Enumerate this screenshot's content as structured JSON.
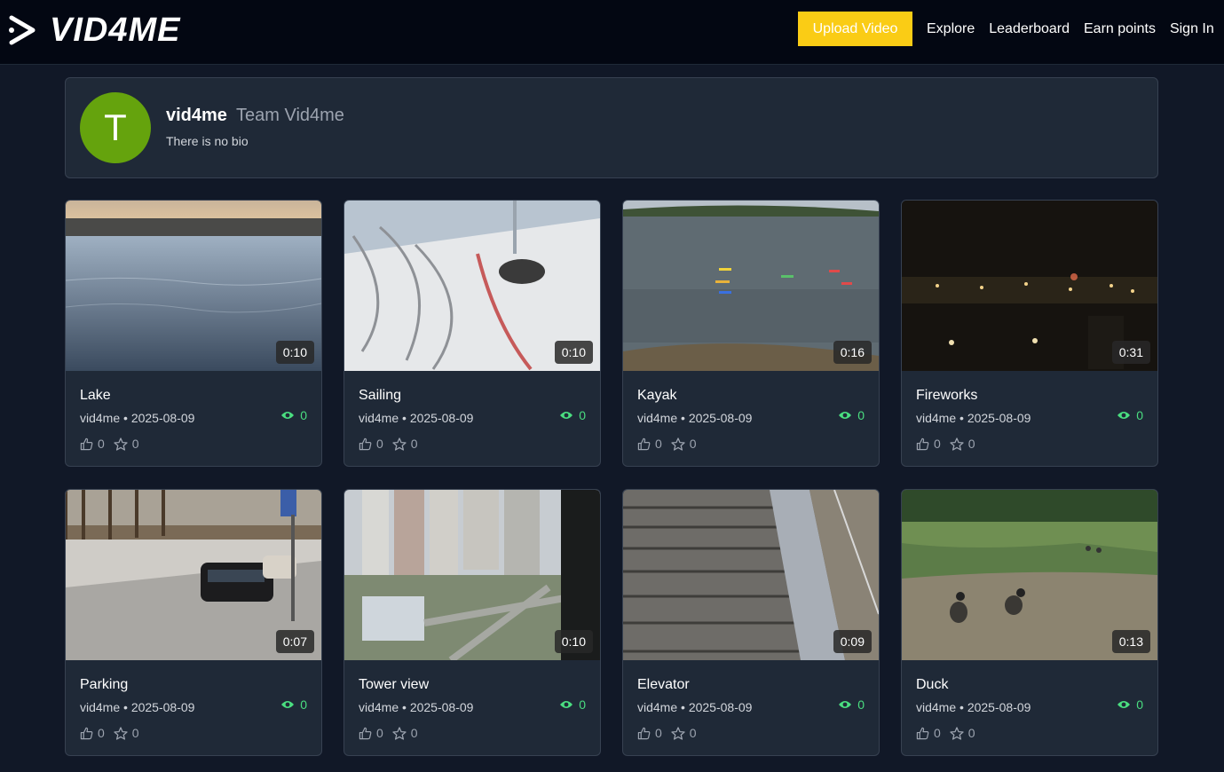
{
  "brand": {
    "name": "VID4ME"
  },
  "nav": {
    "upload_label": "Upload Video",
    "links": [
      "Explore",
      "Leaderboard",
      "Earn points",
      "Sign In"
    ]
  },
  "profile": {
    "avatar_letter": "T",
    "username": "vid4me",
    "team": "Team Vid4me",
    "bio": "There is no bio"
  },
  "colors": {
    "background": "#111827",
    "card": "#1f2937",
    "accent_upload": "#facc15",
    "views": "#4ade80",
    "avatar": "#65a30d"
  },
  "videos": [
    {
      "title": "Lake",
      "author": "vid4me",
      "date": "2025-08-09",
      "duration": "0:10",
      "views": "0",
      "likes": "0",
      "stars": "0"
    },
    {
      "title": "Sailing",
      "author": "vid4me",
      "date": "2025-08-09",
      "duration": "0:10",
      "views": "0",
      "likes": "0",
      "stars": "0"
    },
    {
      "title": "Kayak",
      "author": "vid4me",
      "date": "2025-08-09",
      "duration": "0:16",
      "views": "0",
      "likes": "0",
      "stars": "0"
    },
    {
      "title": "Fireworks",
      "author": "vid4me",
      "date": "2025-08-09",
      "duration": "0:31",
      "views": "0",
      "likes": "0",
      "stars": "0"
    },
    {
      "title": "Parking",
      "author": "vid4me",
      "date": "2025-08-09",
      "duration": "0:07",
      "views": "0",
      "likes": "0",
      "stars": "0"
    },
    {
      "title": "Tower view",
      "author": "vid4me",
      "date": "2025-08-09",
      "duration": "0:10",
      "views": "0",
      "likes": "0",
      "stars": "0"
    },
    {
      "title": "Elevator",
      "author": "vid4me",
      "date": "2025-08-09",
      "duration": "0:09",
      "views": "0",
      "likes": "0",
      "stars": "0"
    },
    {
      "title": "Duck",
      "author": "vid4me",
      "date": "2025-08-09",
      "duration": "0:13",
      "views": "0",
      "likes": "0",
      "stars": "0"
    }
  ],
  "icons": {
    "logo": "play-outline-icon",
    "views": "eye-icon",
    "likes": "thumbs-up-icon",
    "stars": "star-icon"
  }
}
